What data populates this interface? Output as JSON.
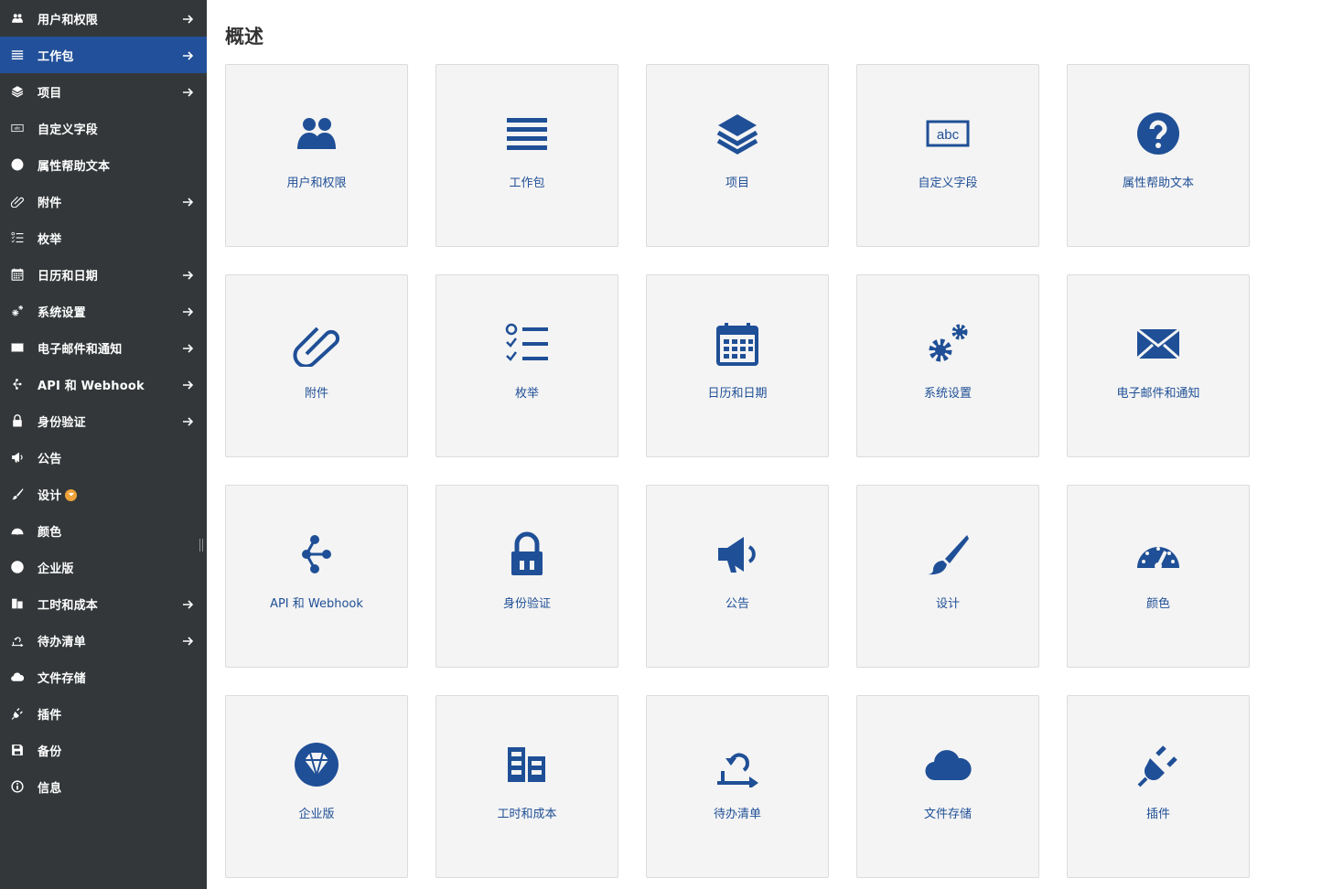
{
  "colors": {
    "sidebar_bg": "#333739",
    "sidebar_active": "#22509a",
    "accent": "#1f4f96",
    "tile_bg": "#f4f4f4",
    "badge": "#f0a23a"
  },
  "sidebar": {
    "items": [
      {
        "label": "用户和权限",
        "icon": "users-icon",
        "arrow": true,
        "active": false
      },
      {
        "label": "工作包",
        "icon": "work-packages-icon",
        "arrow": true,
        "active": true
      },
      {
        "label": "项目",
        "icon": "layers-icon",
        "arrow": true,
        "active": false
      },
      {
        "label": "自定义字段",
        "icon": "custom-field-icon",
        "arrow": false,
        "active": false
      },
      {
        "label": "属性帮助文本",
        "icon": "help-icon",
        "arrow": false,
        "active": false
      },
      {
        "label": "附件",
        "icon": "paperclip-icon",
        "arrow": true,
        "active": false
      },
      {
        "label": "枚举",
        "icon": "enumerations-icon",
        "arrow": false,
        "active": false
      },
      {
        "label": "日历和日期",
        "icon": "calendar-icon",
        "arrow": true,
        "active": false
      },
      {
        "label": "系统设置",
        "icon": "gears-icon",
        "arrow": true,
        "active": false
      },
      {
        "label": "电子邮件和通知",
        "icon": "mail-icon",
        "arrow": true,
        "active": false
      },
      {
        "label": "API 和 Webhook",
        "icon": "webhook-icon",
        "arrow": true,
        "active": false
      },
      {
        "label": "身份验证",
        "icon": "lock-icon",
        "arrow": true,
        "active": false
      },
      {
        "label": "公告",
        "icon": "megaphone-icon",
        "arrow": false,
        "active": false
      },
      {
        "label": "设计",
        "icon": "brush-icon",
        "arrow": false,
        "active": false,
        "badge": "enterprise-badge-icon"
      },
      {
        "label": "颜色",
        "icon": "gauge-icon",
        "arrow": false,
        "active": false
      },
      {
        "label": "企业版",
        "icon": "diamond-icon",
        "arrow": false,
        "active": false
      },
      {
        "label": "工时和成本",
        "icon": "time-cost-icon",
        "arrow": true,
        "active": false
      },
      {
        "label": "待办清单",
        "icon": "backlogs-icon",
        "arrow": true,
        "active": false
      },
      {
        "label": "文件存储",
        "icon": "cloud-icon",
        "arrow": false,
        "active": false
      },
      {
        "label": "插件",
        "icon": "plug-icon",
        "arrow": false,
        "active": false
      },
      {
        "label": "备份",
        "icon": "save-icon",
        "arrow": false,
        "active": false
      },
      {
        "label": "信息",
        "icon": "info-icon",
        "arrow": false,
        "active": false
      }
    ]
  },
  "main": {
    "title": "概述",
    "tiles": [
      {
        "label": "用户和权限",
        "icon": "users-icon"
      },
      {
        "label": "工作包",
        "icon": "work-packages-icon"
      },
      {
        "label": "项目",
        "icon": "layers-icon"
      },
      {
        "label": "自定义字段",
        "icon": "custom-field-icon",
        "icon_text": "abc"
      },
      {
        "label": "属性帮助文本",
        "icon": "help-icon"
      },
      {
        "label": "附件",
        "icon": "paperclip-icon"
      },
      {
        "label": "枚举",
        "icon": "enumerations-icon"
      },
      {
        "label": "日历和日期",
        "icon": "calendar-icon"
      },
      {
        "label": "系统设置",
        "icon": "gears-icon"
      },
      {
        "label": "电子邮件和通知",
        "icon": "mail-icon"
      },
      {
        "label": "API 和 Webhook",
        "icon": "webhook-icon"
      },
      {
        "label": "身份验证",
        "icon": "lock-icon"
      },
      {
        "label": "公告",
        "icon": "megaphone-icon"
      },
      {
        "label": "设计",
        "icon": "brush-icon"
      },
      {
        "label": "颜色",
        "icon": "gauge-icon"
      },
      {
        "label": "企业版",
        "icon": "diamond-icon"
      },
      {
        "label": "工时和成本",
        "icon": "time-cost-icon"
      },
      {
        "label": "待办清单",
        "icon": "backlogs-icon"
      },
      {
        "label": "文件存储",
        "icon": "cloud-icon"
      },
      {
        "label": "插件",
        "icon": "plug-icon"
      }
    ]
  }
}
